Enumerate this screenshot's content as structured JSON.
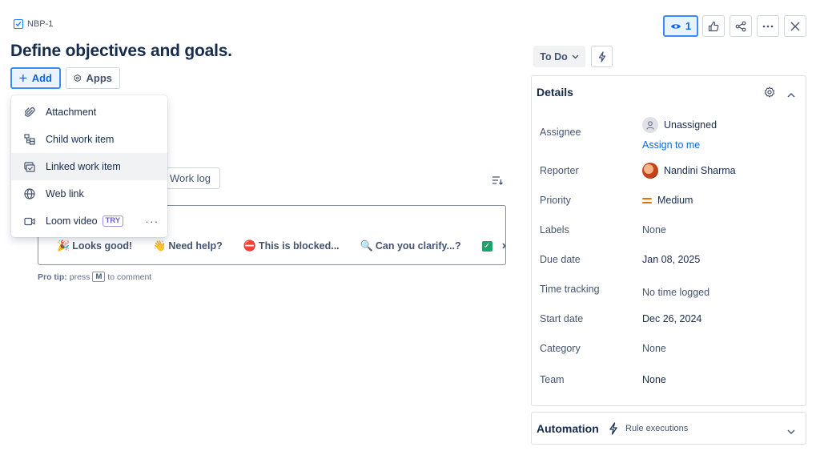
{
  "breadcrumb": {
    "issue_key": "NBP-1"
  },
  "title": "Define objectives and goals.",
  "toolbar": {
    "add_label": "Add",
    "apps_label": "Apps"
  },
  "add_menu": {
    "items": [
      {
        "label": "Attachment",
        "icon": "paperclip-icon"
      },
      {
        "label": "Child work item",
        "icon": "child-item-icon"
      },
      {
        "label": "Linked work item",
        "icon": "link-item-icon"
      },
      {
        "label": "Web link",
        "icon": "globe-icon"
      },
      {
        "label": "Loom video",
        "icon": "video-icon",
        "badge": "TRY"
      }
    ],
    "more": "···"
  },
  "activity": {
    "worklog_tab": "Work log"
  },
  "quick_replies": [
    {
      "emoji": "🎉",
      "label": "Looks good!"
    },
    {
      "emoji": "👋",
      "label": "Need help?"
    },
    {
      "emoji": "⛔",
      "label": "This is blocked..."
    },
    {
      "emoji": "🔍",
      "label": "Can you clarify...?"
    }
  ],
  "quick_replies_next": "›",
  "pro_tip": {
    "prefix": "Pro tip:",
    "press": "press",
    "key": "M",
    "suffix": "to comment"
  },
  "header_actions": {
    "watch_count": "1"
  },
  "status": {
    "label": "To Do"
  },
  "details": {
    "title": "Details",
    "rows": [
      {
        "label": "Assignee",
        "value": "Unassigned",
        "action": "Assign to me"
      },
      {
        "label": "Reporter",
        "value": "Nandini Sharma"
      },
      {
        "label": "Priority",
        "value": "Medium"
      },
      {
        "label": "Labels",
        "value": "None"
      },
      {
        "label": "Due date",
        "value": "Jan 08, 2025"
      },
      {
        "label": "Time tracking",
        "value": "No time logged"
      },
      {
        "label": "Start date",
        "value": "Dec 26, 2024"
      },
      {
        "label": "Category",
        "value": "None"
      },
      {
        "label": "Team",
        "value": "None"
      }
    ]
  },
  "automation": {
    "title": "Automation",
    "subtitle": "Rule executions"
  },
  "colors": {
    "accent": "#0c66e4",
    "priority_medium": "#e2740b",
    "success": "#22a06b"
  }
}
